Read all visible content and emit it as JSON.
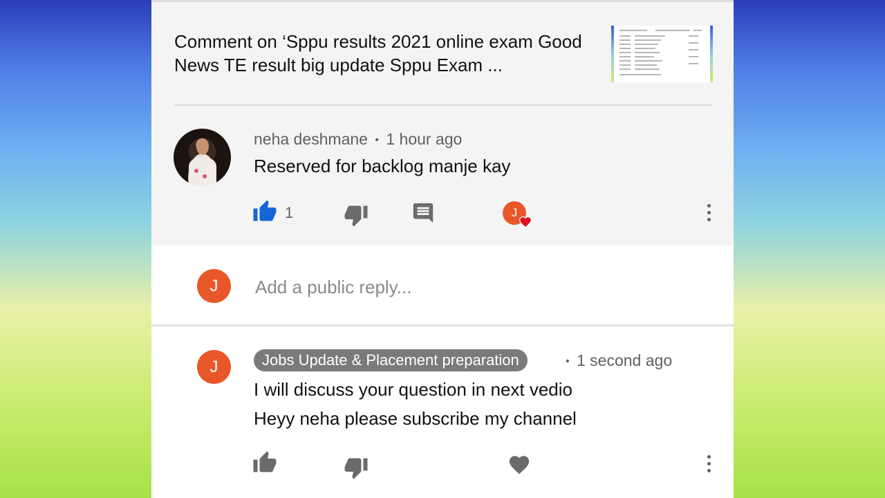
{
  "video": {
    "title": "Comment on ‘Sppu results 2021 online exam Good News TE result  big update  Sppu Exam ..."
  },
  "comment": {
    "author": "neha deshmane",
    "time": "1 hour ago",
    "separator": "•",
    "text": "Reserved for backlog manje kay",
    "likes": "1",
    "hearted_by_initial": "J"
  },
  "reply_box": {
    "avatar_initial": "J",
    "placeholder": "Add a public reply..."
  },
  "reply": {
    "avatar_initial": "J",
    "channel": "Jobs Update & Placement preparation",
    "separator": "•",
    "time": "1 second ago",
    "line1": "I will discuss your question in next vedio",
    "line2": "Heyy neha please subscribe my channel"
  },
  "colors": {
    "like_active": "#1565d8",
    "icon_gray": "#6b6b6b",
    "avatar_orange": "#e8572a",
    "heart_red": "#e0101e"
  },
  "icons": [
    "thumb-up-icon",
    "thumb-down-icon",
    "comment-icon",
    "heart-icon",
    "more-vert-icon"
  ]
}
